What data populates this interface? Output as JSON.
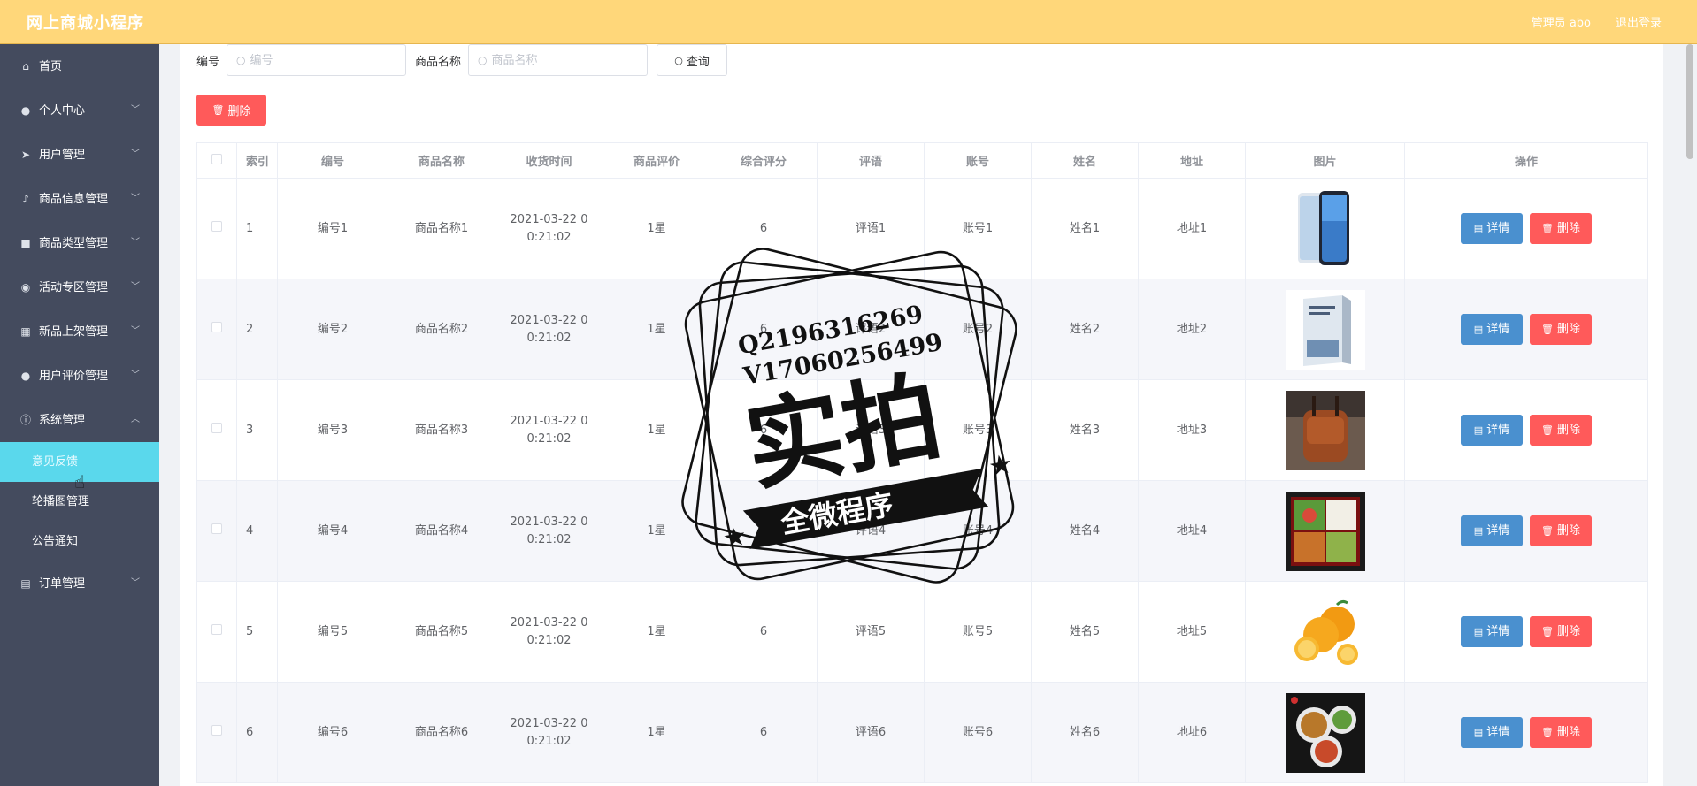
{
  "header": {
    "app_title": "网上商城小程序",
    "user_label": "管理员 abo",
    "logout_label": "退出登录"
  },
  "sidebar": {
    "items": [
      {
        "label": "首页",
        "icon": "home-icon"
      },
      {
        "label": "个人中心",
        "icon": "user-icon"
      },
      {
        "label": "用户管理",
        "icon": "send-icon"
      },
      {
        "label": "商品信息管理",
        "icon": "mic-icon"
      },
      {
        "label": "商品类型管理",
        "icon": "bag-icon"
      },
      {
        "label": "活动专区管理",
        "icon": "location-icon"
      },
      {
        "label": "新品上架管理",
        "icon": "grid-icon"
      },
      {
        "label": "用户评价管理",
        "icon": "user-icon"
      },
      {
        "label": "系统管理",
        "icon": "info-icon"
      },
      {
        "label": "订单管理",
        "icon": "printer-icon"
      }
    ],
    "subitems": [
      {
        "label": "意见反馈",
        "active": true
      },
      {
        "label": "轮播图管理",
        "active": false
      },
      {
        "label": "公告通知",
        "active": false
      }
    ]
  },
  "search": {
    "label_no": "编号",
    "placeholder_no": "编号",
    "label_name": "商品名称",
    "placeholder_name": "商品名称",
    "query_label": "查询"
  },
  "batch_delete_label": "删除",
  "table": {
    "headers": [
      "索引",
      "编号",
      "商品名称",
      "收货时间",
      "商品评价",
      "综合评分",
      "评语",
      "账号",
      "姓名",
      "地址",
      "图片",
      "操作"
    ],
    "detail_label": "详情",
    "delete_label": "删除",
    "rows": [
      {
        "index": "1",
        "no": "编号1",
        "name": "商品名称1",
        "time": "2021-03-22 00:21:02",
        "rating": "1星",
        "score": "6",
        "comment": "评语1",
        "account": "账号1",
        "person": "姓名1",
        "address": "地址1",
        "image": "phone"
      },
      {
        "index": "2",
        "no": "编号2",
        "name": "商品名称2",
        "time": "2021-03-22 00:21:02",
        "rating": "1星",
        "score": "6",
        "comment": "评语2",
        "account": "账号2",
        "person": "姓名2",
        "address": "地址2",
        "image": "book"
      },
      {
        "index": "3",
        "no": "编号3",
        "name": "商品名称3",
        "time": "2021-03-22 00:21:02",
        "rating": "1星",
        "score": "6",
        "comment": "评语3",
        "account": "账号3",
        "person": "姓名3",
        "address": "地址3",
        "image": "bag"
      },
      {
        "index": "4",
        "no": "编号4",
        "name": "商品名称4",
        "time": "2021-03-22 00:21:02",
        "rating": "1星",
        "score": "6",
        "comment": "评语4",
        "account": "账号4",
        "person": "姓名4",
        "address": "地址4",
        "image": "bento"
      },
      {
        "index": "5",
        "no": "编号5",
        "name": "商品名称5",
        "time": "2021-03-22 00:21:02",
        "rating": "1星",
        "score": "6",
        "comment": "评语5",
        "account": "账号5",
        "person": "姓名5",
        "address": "地址5",
        "image": "oranges"
      },
      {
        "index": "6",
        "no": "编号6",
        "name": "商品名称6",
        "time": "2021-03-22 00:21:02",
        "rating": "1星",
        "score": "6",
        "comment": "评语6",
        "account": "账号6",
        "person": "姓名6",
        "address": "地址6",
        "image": "food"
      }
    ]
  },
  "watermark": {
    "line1": "Q2196316269",
    "line2": "V17060256499",
    "big": "实拍",
    "banner": "全微程序"
  }
}
